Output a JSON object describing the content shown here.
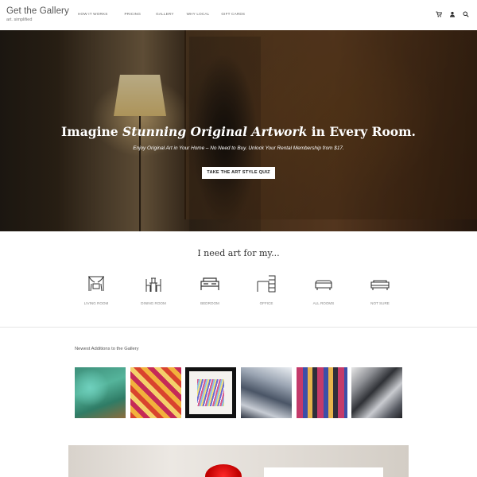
{
  "header": {
    "logo_title": "Get the Gallery",
    "logo_subtitle": "art. simplified",
    "nav": [
      "HOW IT WORKS",
      "PRICING",
      "GALLERY",
      "WHY LOCAL",
      "GIFT CARDS"
    ],
    "icons": [
      "cart-icon",
      "user-icon",
      "search-icon"
    ]
  },
  "hero": {
    "headline_pre": "Imagine ",
    "headline_em": "Stunning Original Artwork",
    "headline_post": " in Every Room.",
    "subheadline": "Enjoy Original Art in Your Home – No Need to Buy. Unlock Your Rental Membership from $17.",
    "cta": "TAKE THE ART STYLE QUIZ"
  },
  "rooms": {
    "title": "I need art for my...",
    "items": [
      {
        "label": "LIVING ROOM",
        "icon": "living-room-icon"
      },
      {
        "label": "DINING ROOM",
        "icon": "dining-room-icon"
      },
      {
        "label": "BEDROOM",
        "icon": "bedroom-icon"
      },
      {
        "label": "OFFICE",
        "icon": "office-icon"
      },
      {
        "label": "ALL ROOMS",
        "icon": "all-rooms-icon"
      },
      {
        "label": "NOT SURE",
        "icon": "not-sure-icon"
      }
    ]
  },
  "gallery": {
    "title": "Newest Additions to the Gallery",
    "artworks": 6
  }
}
